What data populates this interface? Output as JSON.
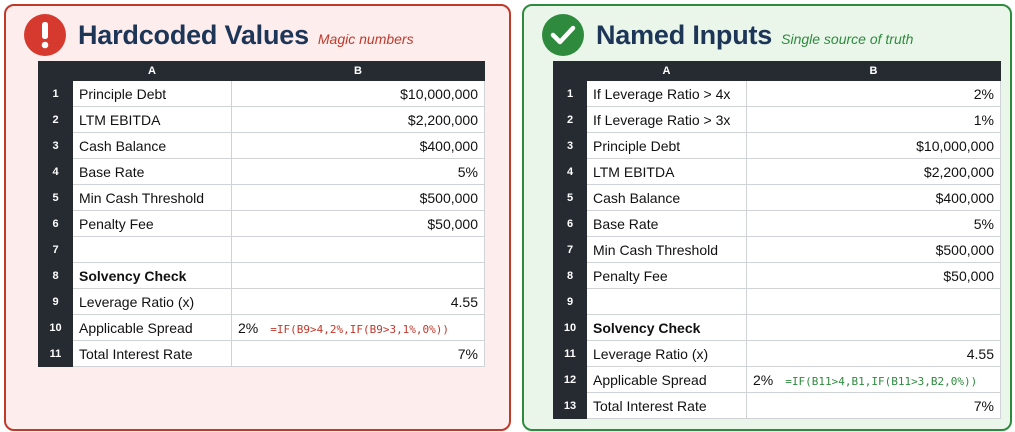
{
  "left_panel": {
    "title": "Hardcoded Values",
    "subtitle": "Magic numbers",
    "icon": "exclamation-icon",
    "accent": "#c0392b",
    "columns": [
      "A",
      "B"
    ],
    "rows": [
      {
        "num": "1",
        "a": "Principle Debt",
        "b": "$10,000,000"
      },
      {
        "num": "2",
        "a": "LTM EBITDA",
        "b": "$2,200,000"
      },
      {
        "num": "3",
        "a": "Cash Balance",
        "b": "$400,000"
      },
      {
        "num": "4",
        "a": "Base Rate",
        "b": "5%"
      },
      {
        "num": "5",
        "a": "Min Cash Threshold",
        "b": "$500,000"
      },
      {
        "num": "6",
        "a": "Penalty Fee",
        "b": "$50,000"
      },
      {
        "num": "7",
        "a": "",
        "b": ""
      },
      {
        "num": "8",
        "a": "Solvency Check",
        "b": ""
      },
      {
        "num": "9",
        "a": "Leverage Ratio (x)",
        "b": "4.55"
      },
      {
        "num": "10",
        "a": "Applicable Spread",
        "b": "2%",
        "formula": "=IF(B9>4,2%,IF(B9>3,1%,0%))"
      },
      {
        "num": "11",
        "a": "Total Interest Rate",
        "b": "7%"
      }
    ]
  },
  "right_panel": {
    "title": "Named Inputs",
    "subtitle": "Single source of truth",
    "icon": "checkmark-icon",
    "accent": "#2e8b3e",
    "columns": [
      "A",
      "B"
    ],
    "rows": [
      {
        "num": "1",
        "a": "If Leverage Ratio > 4x",
        "b": "2%"
      },
      {
        "num": "2",
        "a": "If Leverage Ratio > 3x",
        "b": "1%"
      },
      {
        "num": "3",
        "a": "Principle Debt",
        "b": "$10,000,000"
      },
      {
        "num": "4",
        "a": "LTM EBITDA",
        "b": "$2,200,000"
      },
      {
        "num": "5",
        "a": "Cash Balance",
        "b": "$400,000"
      },
      {
        "num": "6",
        "a": "Base Rate",
        "b": "5%"
      },
      {
        "num": "7",
        "a": "Min Cash Threshold",
        "b": "$500,000"
      },
      {
        "num": "8",
        "a": "Penalty Fee",
        "b": "$50,000"
      },
      {
        "num": "9",
        "a": "",
        "b": ""
      },
      {
        "num": "10",
        "a": "Solvency Check",
        "b": ""
      },
      {
        "num": "11",
        "a": "Leverage Ratio (x)",
        "b": "4.55"
      },
      {
        "num": "12",
        "a": "Applicable Spread",
        "b": "2%",
        "formula": "=IF(B11>4,B1,IF(B11>3,B2,0%))"
      },
      {
        "num": "13",
        "a": "Total Interest Rate",
        "b": "7%"
      }
    ]
  }
}
